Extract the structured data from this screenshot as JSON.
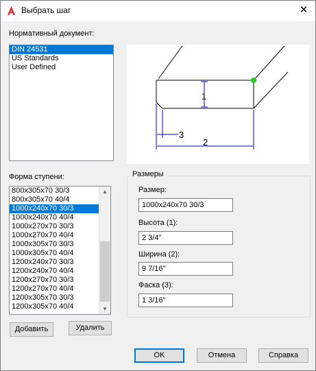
{
  "window": {
    "title": "Выбрать шаг",
    "close_glyph": "✕"
  },
  "normative": {
    "label": "Нормативный документ:",
    "items": [
      "DIN 24531",
      "US Standards",
      "User Defined"
    ],
    "selected": "DIN 24531"
  },
  "step_form": {
    "label": "Форма ступени:",
    "items": [
      "800x305x70 30/3",
      "800x305x70 40/4",
      "1000x240x70 30/3",
      "1000x240x70 40/4",
      "1000x270x70 30/3",
      "1000x270x70 40/4",
      "1000x305x70 30/3",
      "1000x305x70 40/4",
      "1200x240x70 30/3",
      "1200x240x70 40/4",
      "1200x270x70 30/3",
      "1200x270x70 40/4",
      "1200x305x70 30/3",
      "1200x305x70 40/4"
    ],
    "selected": "1000x240x70 30/3"
  },
  "diagram": {
    "labels": [
      "1",
      "2",
      "3"
    ],
    "marker_color": "#22cc22",
    "dimension_color": "#0000cc"
  },
  "dimensions": {
    "group_title": "Размеры",
    "size_label": "Размер:",
    "size_value": "1000x240x70 30/3",
    "height_label": "Высота (1):",
    "height_value": "2 3/4\"",
    "width_label": "Ширина (2):",
    "width_value": "9 7/16\"",
    "chamfer_label": "Фаска (3):",
    "chamfer_value": "1 3/16\""
  },
  "buttons": {
    "add": "Добавить",
    "delete": "Удалить",
    "ok": "OK",
    "cancel": "Отмена",
    "help": "Справка"
  }
}
